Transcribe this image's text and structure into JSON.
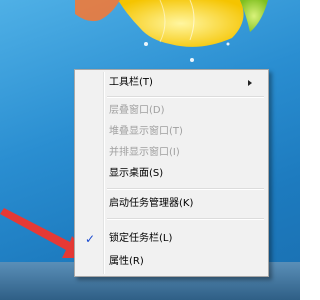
{
  "context_menu": {
    "items": [
      {
        "label": "工具栏(T)",
        "enabled": true,
        "has_submenu": true
      },
      {
        "label": "层叠窗口(D)",
        "enabled": false
      },
      {
        "label": "堆叠显示窗口(T)",
        "enabled": false
      },
      {
        "label": "并排显示窗口(I)",
        "enabled": false
      },
      {
        "label": "显示桌面(S)",
        "enabled": true
      },
      {
        "label": "启动任务管理器(K)",
        "enabled": true
      },
      {
        "label": "锁定任务栏(L)",
        "enabled": true,
        "checked": true
      },
      {
        "label": "属性(R)",
        "enabled": true
      }
    ]
  },
  "colors": {
    "desktop": "#2a8ed1",
    "menu_bg": "#f1f1f1",
    "annotation_arrow": "#e53935",
    "check": "#1a4bd0"
  },
  "icons": {
    "check": "✓"
  }
}
